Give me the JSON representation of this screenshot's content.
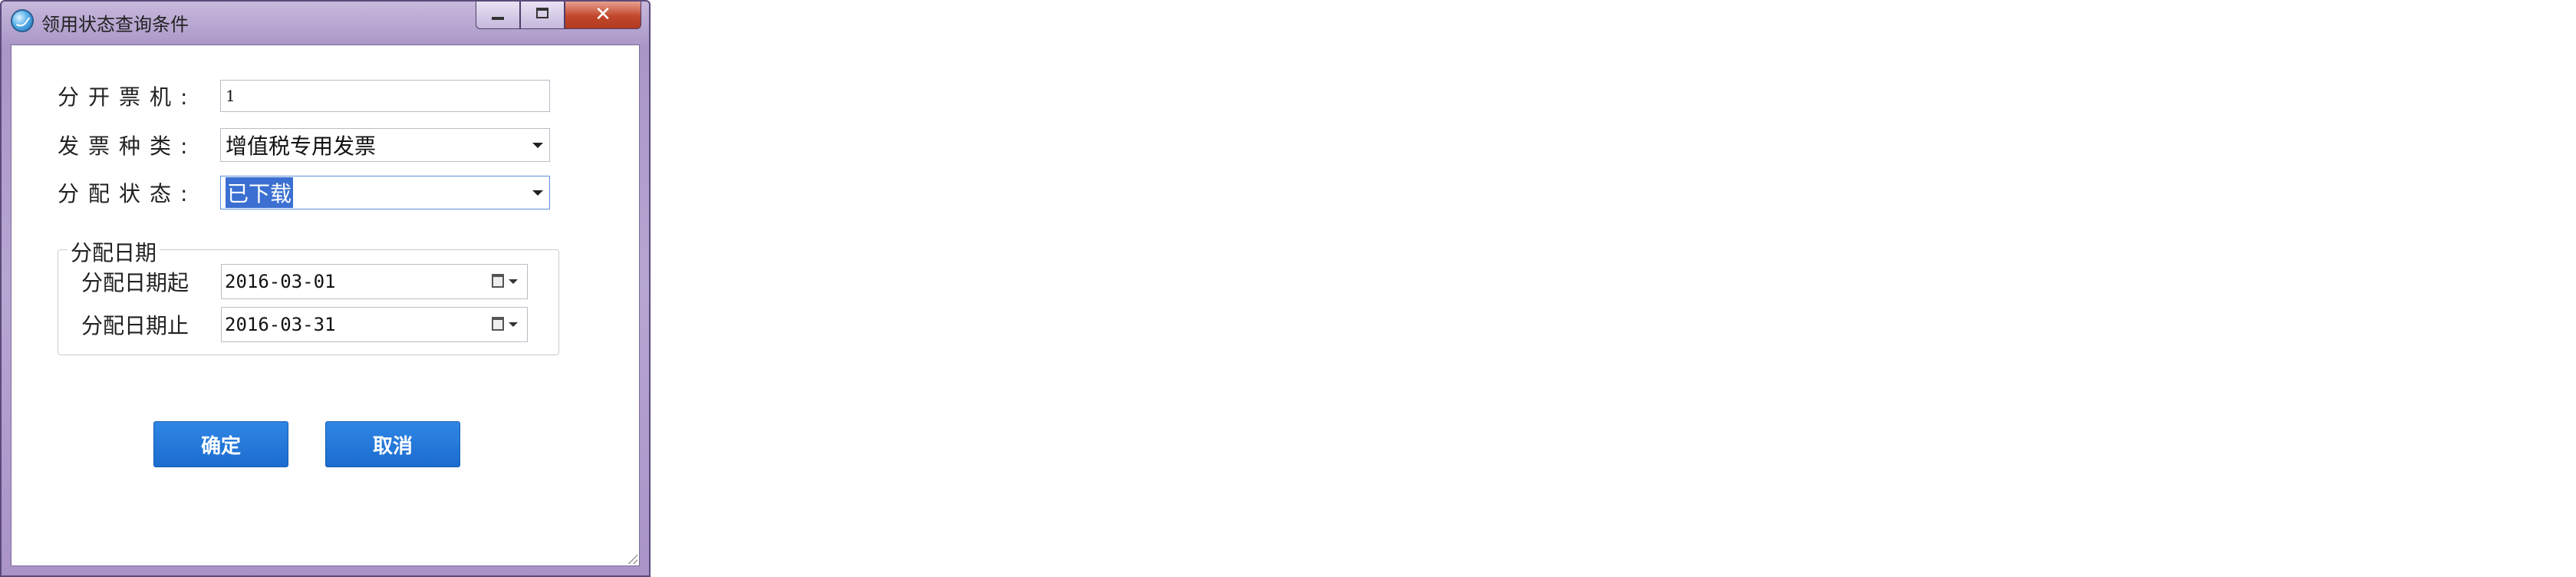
{
  "window": {
    "title": "领用状态查询条件",
    "controls": {
      "minimize_icon": "minimize-icon",
      "maximize_icon": "maximize-icon",
      "close_label": "✕"
    }
  },
  "form": {
    "machine": {
      "label": "分开票机:",
      "value": "1"
    },
    "invoice_type": {
      "label": "发票种类:",
      "value": "增值税专用发票"
    },
    "status": {
      "label": "分配状态:",
      "value": "已下载"
    }
  },
  "date_group": {
    "title": "分配日期",
    "start": {
      "label": "分配日期起",
      "value": "2016-03-01"
    },
    "end": {
      "label": "分配日期止",
      "value": "2016-03-31"
    }
  },
  "buttons": {
    "confirm": "确定",
    "cancel": "取消"
  },
  "colors": {
    "accent": "#1c6cd0",
    "selection": "#3b6fd1",
    "frame": "#a996c7"
  }
}
